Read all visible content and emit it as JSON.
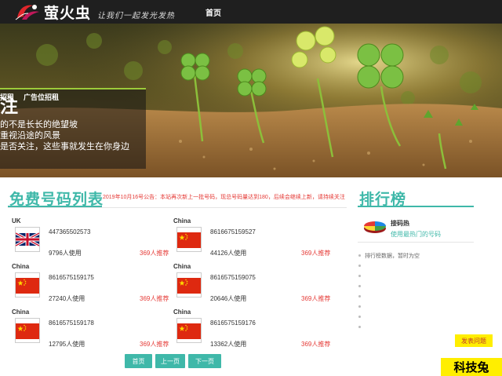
{
  "header": {
    "logo_name": "萤火虫",
    "logo_slogan": "让我们一起发光发热",
    "nav_home": "首页"
  },
  "hero": {
    "title": "注",
    "lines": [
      "的不是长长的绝望坡",
      "重视沿途的风景",
      "是否关注，这些事就发生在你身边"
    ],
    "links": [
      "招租",
      "广告位招租"
    ]
  },
  "main": {
    "section_title": "免费号码列表",
    "notice": "2019年10月16号公告：本站再次新上一批号码，现总号码量达到180，后续会继续上新，请持续关注",
    "numbers": [
      {
        "country": "UK",
        "flag": "uk",
        "number": "447365502573",
        "usage": "9796人使用",
        "recommend": "369人推荐"
      },
      {
        "country": "China",
        "flag": "china",
        "number": "8616675159527",
        "usage": "44126人使用",
        "recommend": "369人推荐"
      },
      {
        "country": "China",
        "flag": "china",
        "number": "8616575159175",
        "usage": "27240人使用",
        "recommend": "369人推荐"
      },
      {
        "country": "China",
        "flag": "china",
        "number": "8616575159075",
        "usage": "20646人使用",
        "recommend": "369人推荐"
      },
      {
        "country": "China",
        "flag": "china",
        "number": "8616575159178",
        "usage": "12795人使用",
        "recommend": "369人推荐"
      },
      {
        "country": "China",
        "flag": "china",
        "number": "8616575159176",
        "usage": "13362人使用",
        "recommend": "369人推荐"
      }
    ],
    "pagination": {
      "first": "首页",
      "prev": "上一页",
      "next": "下一页"
    }
  },
  "sidebar": {
    "title": "排行榜",
    "top_item": {
      "name": "接码热",
      "desc": "使用最热门的号码",
      "icon": "pie-chart-icon"
    },
    "empty_text": "排行榜数据，暂时为空"
  },
  "feedback_label": "发表问题",
  "watermark": "科技兔",
  "colors": {
    "accent": "#3fb8a9",
    "notice_red": "#e53935",
    "topbar": "#1f1f1f",
    "highlight_yellow": "#ffee00"
  }
}
